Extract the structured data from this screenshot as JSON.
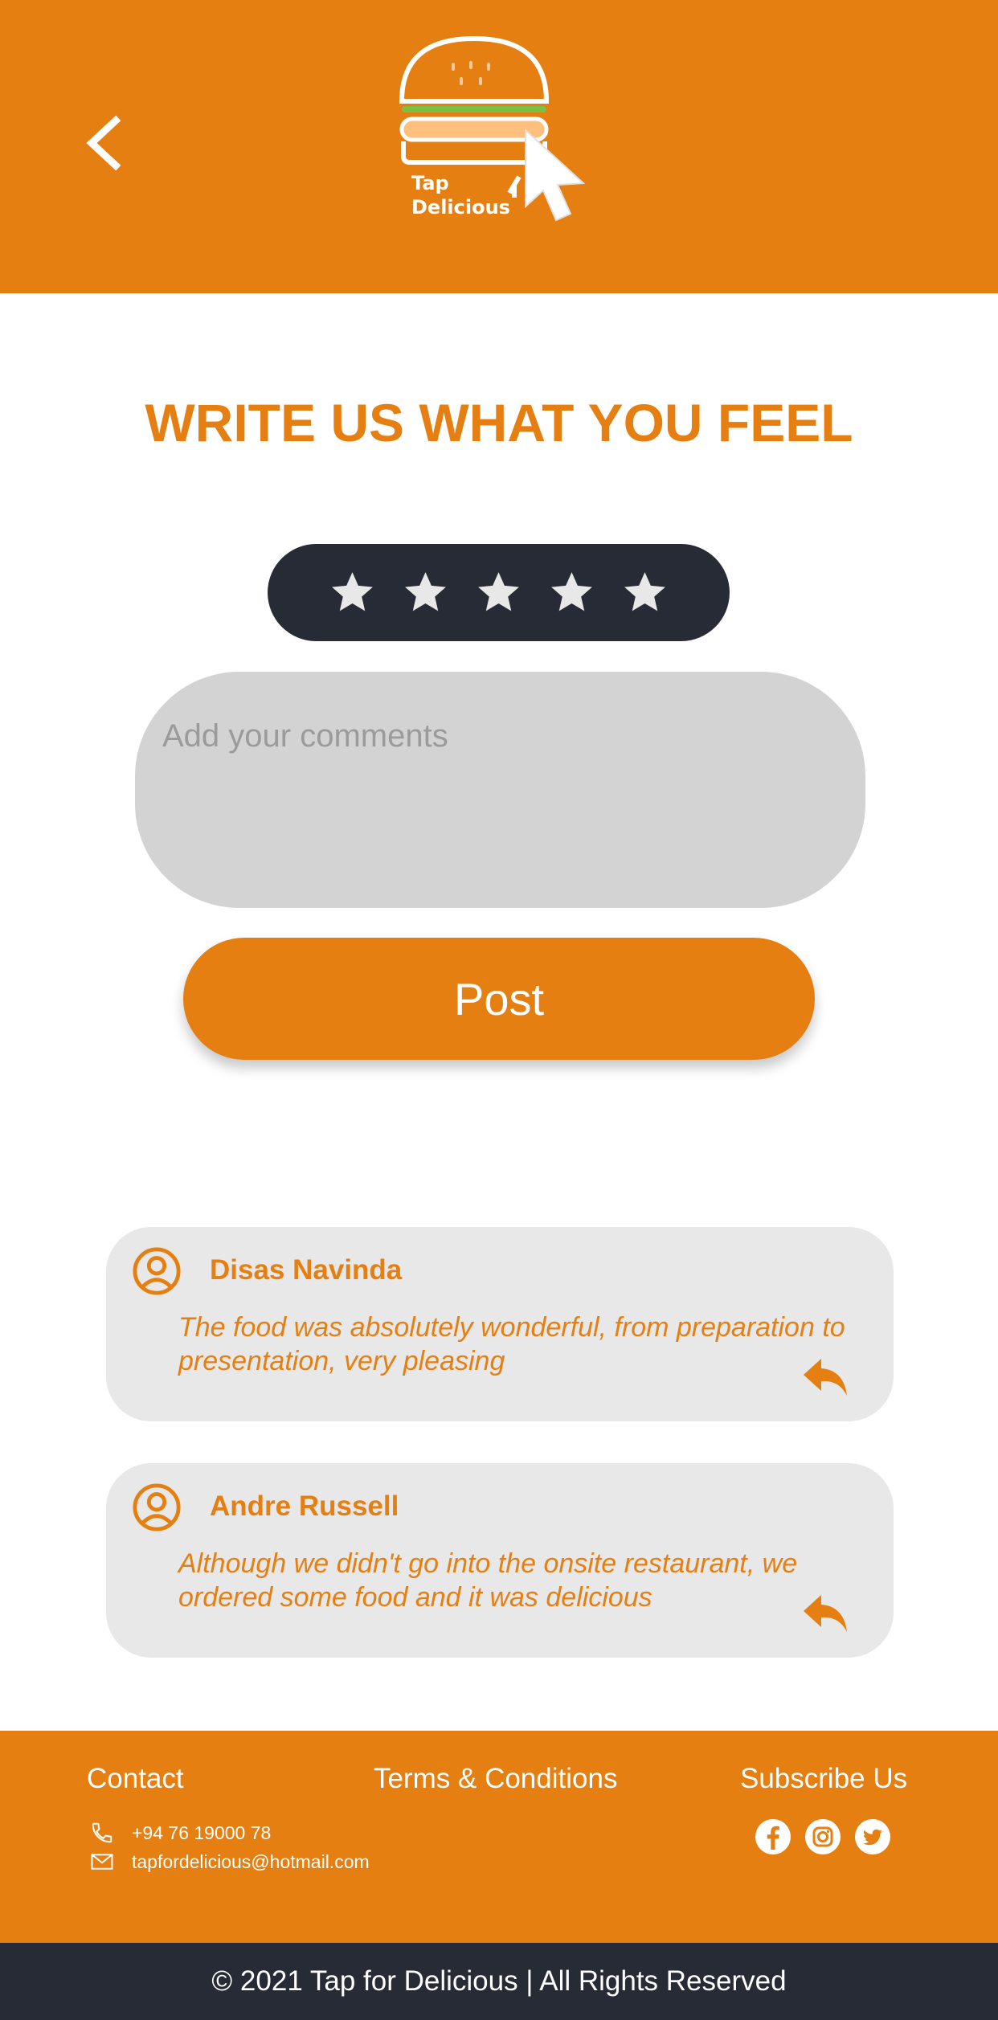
{
  "header": {
    "logo_line1": "Tap",
    "logo_line2": "Delicious"
  },
  "colors": {
    "accent": "#E67F12",
    "dark": "#272B36",
    "card": "#E8E8E8",
    "input": "#D3D3D3"
  },
  "page_title": "WRITE US WHAT YOU FEEL",
  "rating": {
    "stars": 5
  },
  "comment": {
    "placeholder": "Add your comments",
    "value": ""
  },
  "post_label": "Post",
  "reviews": [
    {
      "name": "Disas Navinda",
      "text": "The food was absolutely wonderful, from preparation to presentation, very pleasing"
    },
    {
      "name": "Andre Russell",
      "text": "Although we didn't go into the onsite restaurant, we ordered some food and it was delicious"
    }
  ],
  "footer": {
    "contact_heading": "Contact",
    "terms_heading": "Terms & Conditions",
    "subscribe_heading": "Subscribe Us",
    "phone": "+94 76 19000 78",
    "email": "tapfordelicious@hotmail.com",
    "social_icons": [
      "facebook-icon",
      "instagram-icon",
      "twitter-icon"
    ]
  },
  "copyright": "© 2021 Tap for Delicious | All Rights Reserved"
}
